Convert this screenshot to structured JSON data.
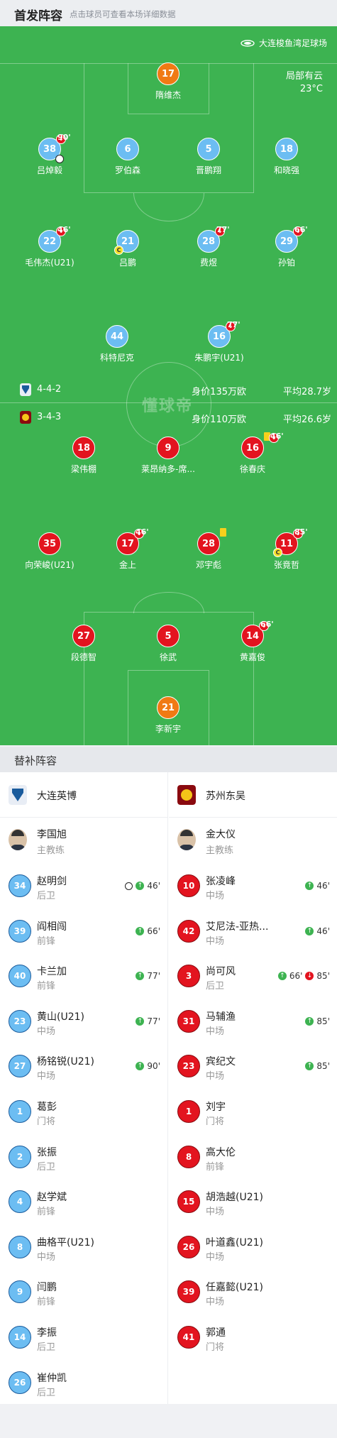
{
  "header": {
    "title": "首发阵容",
    "subtitle": "点击球员可查看本场详细数据"
  },
  "venue": {
    "name": "大连梭鱼湾足球场",
    "icon": "stadium-icon"
  },
  "weather": {
    "condition": "局部有云",
    "temp": "23°C"
  },
  "watermark": "懂球帝",
  "home_team": {
    "name": "大连英博",
    "formation": "4-4-2",
    "value": "身价135万欧",
    "avg_age": "平均28.7岁",
    "color": "#6cbdf2"
  },
  "away_team": {
    "name": "苏州东吴",
    "formation": "3-4-3",
    "value": "身价110万欧",
    "avg_age": "平均26.6岁",
    "color": "#e3141f"
  },
  "home_lineup": [
    {
      "num": "17",
      "name": "隋维杰"
    },
    {
      "num": "38",
      "name": "吕焯毅",
      "out": "90'"
    },
    {
      "num": "6",
      "name": "罗伯森"
    },
    {
      "num": "5",
      "name": "晋鹏翔"
    },
    {
      "num": "18",
      "name": "和晓强"
    },
    {
      "num": "22",
      "name": "毛伟杰(U21)",
      "out": "46'"
    },
    {
      "num": "21",
      "name": "吕鹏"
    },
    {
      "num": "28",
      "name": "费煜",
      "out": "77'"
    },
    {
      "num": "29",
      "name": "孙铂",
      "out": "66'"
    },
    {
      "num": "44",
      "name": "科特尼克"
    },
    {
      "num": "16",
      "name": "朱鹏宇(U21)",
      "out": "77'"
    }
  ],
  "away_lineup": [
    {
      "num": "18",
      "name": "梁伟棚"
    },
    {
      "num": "9",
      "name": "莱昂纳多-席..."
    },
    {
      "num": "16",
      "name": "徐春庆",
      "out": "46'"
    },
    {
      "num": "35",
      "name": "向荣峻(U21)"
    },
    {
      "num": "17",
      "name": "金上",
      "out": "46'"
    },
    {
      "num": "28",
      "name": "邓宇彪"
    },
    {
      "num": "11",
      "name": "张竟哲",
      "out": "85'"
    },
    {
      "num": "27",
      "name": "段德智"
    },
    {
      "num": "5",
      "name": "徐武"
    },
    {
      "num": "14",
      "name": "黄嘉俊",
      "out": "66'"
    },
    {
      "num": "21",
      "name": "李新宇"
    }
  ],
  "subs_section": {
    "title": "替补阵容"
  },
  "home_subs": {
    "coach": {
      "name": "李国旭",
      "role": "主教练"
    },
    "players": [
      {
        "num": "34",
        "name": "赵明剑",
        "pos": "后卫",
        "in": "46'",
        "goal": true
      },
      {
        "num": "39",
        "name": "阎相闯",
        "pos": "前锋",
        "in": "66'"
      },
      {
        "num": "40",
        "name": "卡兰加",
        "pos": "前锋",
        "in": "77'"
      },
      {
        "num": "23",
        "name": "黄山(U21)",
        "pos": "中场",
        "in": "77'"
      },
      {
        "num": "27",
        "name": "杨铭锐(U21)",
        "pos": "中场",
        "in": "90'"
      },
      {
        "num": "1",
        "name": "葛彭",
        "pos": "门将"
      },
      {
        "num": "2",
        "name": "张振",
        "pos": "后卫"
      },
      {
        "num": "4",
        "name": "赵学斌",
        "pos": "前锋"
      },
      {
        "num": "8",
        "name": "曲格平(U21)",
        "pos": "中场"
      },
      {
        "num": "9",
        "name": "闫鹏",
        "pos": "前锋"
      },
      {
        "num": "14",
        "name": "李振",
        "pos": "后卫"
      },
      {
        "num": "26",
        "name": "崔仲凯",
        "pos": "后卫"
      }
    ]
  },
  "away_subs": {
    "coach": {
      "name": "金大仪",
      "role": "主教练"
    },
    "players": [
      {
        "num": "10",
        "name": "张凌峰",
        "pos": "中场",
        "in": "46'"
      },
      {
        "num": "42",
        "name": "艾尼法-亚热...",
        "pos": "中场",
        "in": "46'"
      },
      {
        "num": "3",
        "name": "尚可风",
        "pos": "后卫",
        "in": "66'",
        "out": "85'"
      },
      {
        "num": "31",
        "name": "马辅渔",
        "pos": "中场",
        "in": "85'"
      },
      {
        "num": "23",
        "name": "宾纪文",
        "pos": "中场",
        "in": "85'"
      },
      {
        "num": "1",
        "name": "刘宇",
        "pos": "门将"
      },
      {
        "num": "8",
        "name": "高大伦",
        "pos": "前锋"
      },
      {
        "num": "15",
        "name": "胡浩越(U21)",
        "pos": "中场"
      },
      {
        "num": "26",
        "name": "叶道鑫(U21)",
        "pos": "中场"
      },
      {
        "num": "39",
        "name": "任嘉懿(U21)",
        "pos": "中场"
      },
      {
        "num": "41",
        "name": "郭通",
        "pos": "门将"
      }
    ]
  }
}
